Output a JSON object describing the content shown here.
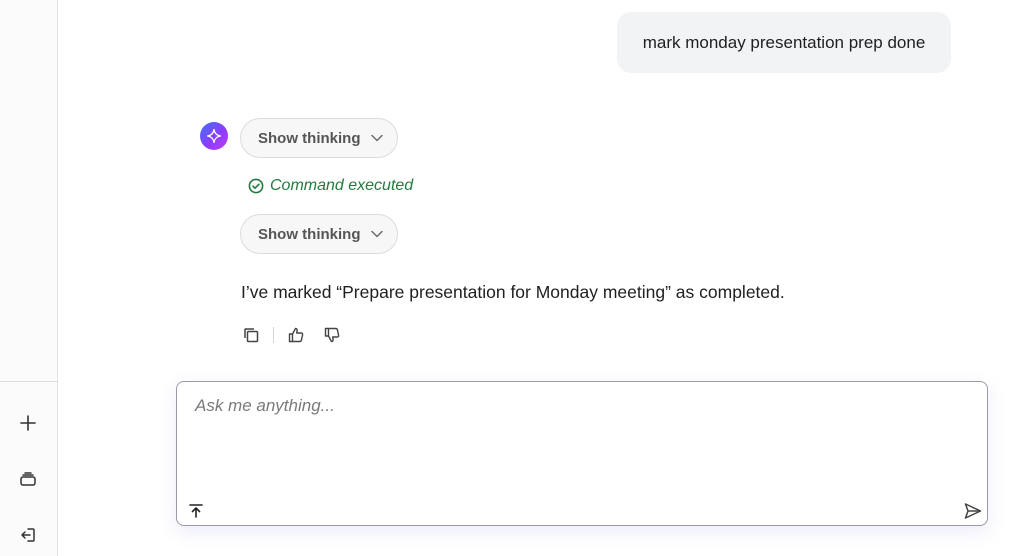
{
  "sidebar": {
    "buttons": [
      {
        "icon": "plus-icon"
      },
      {
        "icon": "archive-icon"
      },
      {
        "icon": "logout-icon"
      }
    ]
  },
  "conversation": {
    "user_message": "mark monday presentation prep done",
    "assistant": {
      "thinking_label_1": "Show thinking",
      "command_status": "Command executed",
      "thinking_label_2": "Show thinking",
      "reply": "I’ve marked “Prepare presentation for Monday meeting” as completed.",
      "actions": [
        "copy-icon",
        "thumbs-up-icon",
        "thumbs-down-icon"
      ]
    }
  },
  "composer": {
    "placeholder": "Ask me anything...",
    "value": ""
  },
  "colors": {
    "success": "#237a3d",
    "avatar_gradient": [
      "#3f73ff",
      "#8b3dff",
      "#c13df0"
    ]
  }
}
